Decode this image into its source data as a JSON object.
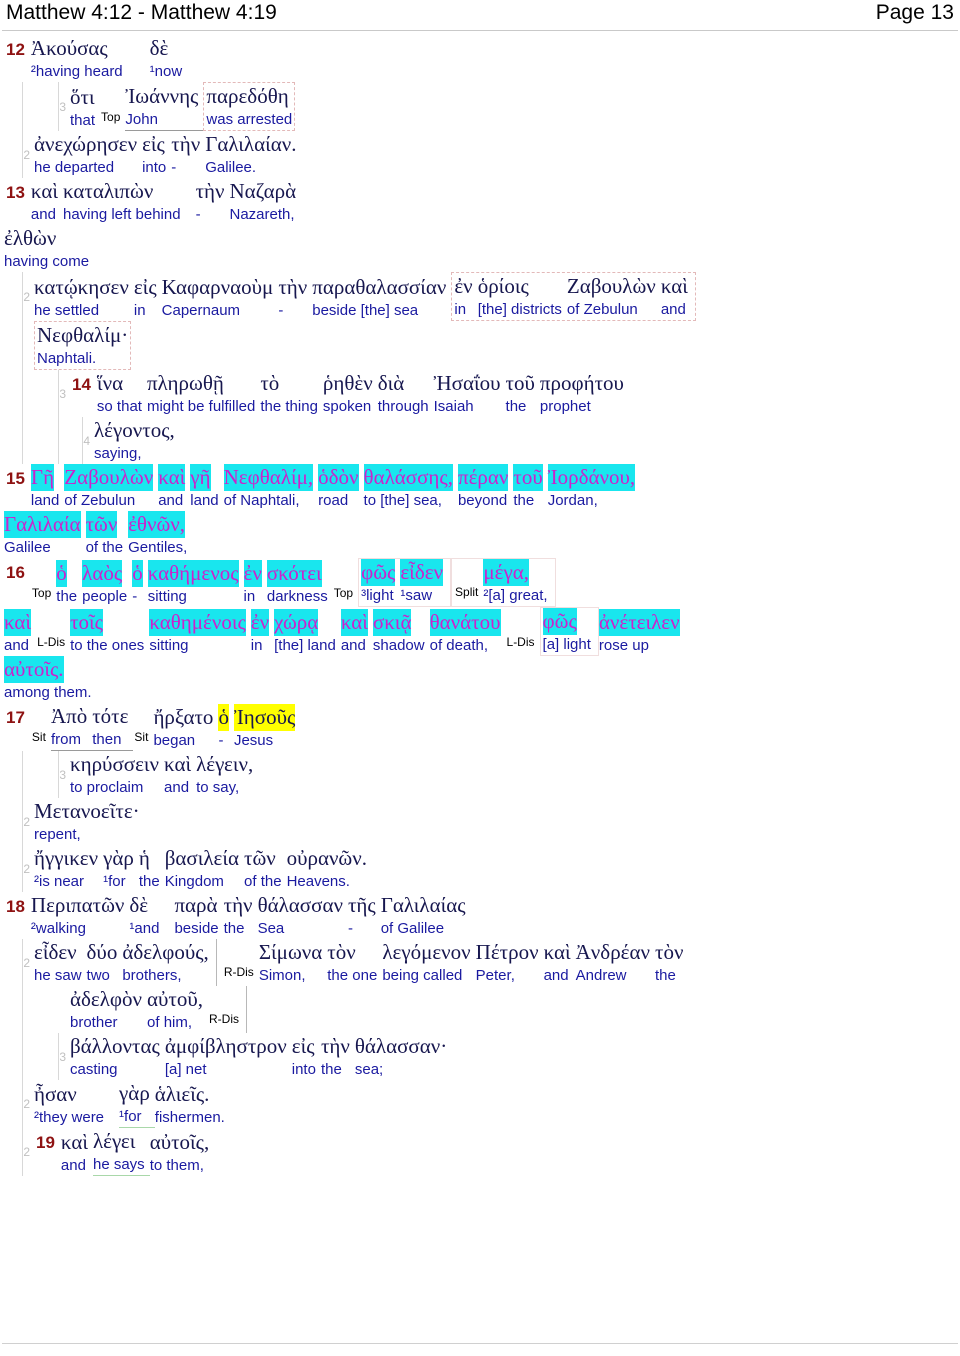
{
  "header": {
    "range_title": "Matthew 4:12 - Matthew 4:19",
    "page_label": "Page 13"
  },
  "colors": {
    "verse_number": "#8e1212",
    "greek_text": "#17174f",
    "english_gloss": "#1a1aa0",
    "highlight_cyan": "#19e6ee",
    "highlight_cyan_text": "#cc22cc",
    "highlight_yellow": "#ffff00",
    "indent_marker": "#c0c0c0",
    "box_dashed": "#e3b9b9"
  },
  "tags": {
    "top": "Top",
    "split": "Split",
    "sit": "Sit",
    "l_dis": "L-Dis",
    "r_dis": "R-Dis"
  },
  "indent_levels": {
    "two": "2",
    "three": "3",
    "four": "4"
  },
  "verses": [
    {
      "number": "12",
      "lines": [
        {
          "indent": "0",
          "words": [
            {
              "gk": "Ἀκούσας",
              "en": "²having heard"
            },
            {
              "gk": "δὲ",
              "en": "¹now"
            }
          ]
        },
        {
          "indent": "3",
          "words": [
            {
              "gk": "ὅτι",
              "en": "that"
            },
            {
              "tag": "Top"
            },
            {
              "gk": "Ἰωάννης",
              "en": "John"
            },
            {
              "gk": "παρεδόθη",
              "en": "was arrested"
            }
          ]
        },
        {
          "indent": "2",
          "words": [
            {
              "gk": "ἀνεχώρησεν",
              "en": "he departed"
            },
            {
              "gk": "εἰς",
              "en": "into"
            },
            {
              "gk": "τὴν",
              "en": "-"
            },
            {
              "gk": "Γαλιλαίαν.",
              "en": "Galilee."
            }
          ]
        }
      ]
    },
    {
      "number": "13",
      "lines": [
        {
          "indent": "0",
          "words": [
            {
              "gk": "καὶ",
              "en": "and"
            },
            {
              "gk": "καταλιπὼν",
              "en": "having left behind"
            },
            {
              "gk": "τὴν",
              "en": "-"
            },
            {
              "gk": "Ναζαρὰ",
              "en": "Nazareth,"
            }
          ]
        },
        {
          "indent": "0",
          "words": [
            {
              "gk": "ἐλθὼν",
              "en": "having come"
            }
          ]
        },
        {
          "indent": "2",
          "words": [
            {
              "gk": "κατῴκησεν",
              "en": "he settled"
            },
            {
              "gk": "εἰς",
              "en": "in"
            },
            {
              "gk": "Καφαρναοὺμ",
              "en": "Capernaum"
            },
            {
              "gk": "τὴν",
              "en": "-"
            },
            {
              "gk": "παραθαλασσίαν",
              "en": "beside [the] sea"
            },
            {
              "gk": "ἐν",
              "en": "in"
            },
            {
              "gk": "ὁρίοις",
              "en": "[the] districts"
            },
            {
              "gk": "Ζαβουλὼν",
              "en": "of Zebulun"
            },
            {
              "gk": "καὶ",
              "en": "and"
            }
          ]
        },
        {
          "indent": "0",
          "words": [
            {
              "gk": "Νεφθαλίμ·",
              "en": "Naphtali."
            }
          ]
        }
      ]
    },
    {
      "number": "14",
      "lines": [
        {
          "indent": "3",
          "words": [
            {
              "gk": "ἵνα",
              "en": "so that"
            },
            {
              "gk": "πληρωθῇ",
              "en": "might be fulfilled"
            },
            {
              "gk": "τὸ",
              "en": "the thing"
            },
            {
              "gk": "ῥηθὲν",
              "en": "spoken"
            },
            {
              "gk": "διὰ",
              "en": "through"
            },
            {
              "gk": "Ἠσαΐου",
              "en": "Isaiah"
            },
            {
              "gk": "τοῦ",
              "en": "the"
            },
            {
              "gk": "προφήτου",
              "en": "prophet"
            }
          ]
        },
        {
          "indent": "4",
          "words": [
            {
              "gk": "λέγοντος,",
              "en": "saying,"
            }
          ]
        }
      ]
    },
    {
      "number": "15",
      "lines": [
        {
          "indent": "0",
          "highlight": "cyan",
          "words": [
            {
              "gk": "Γῆ",
              "en": "land"
            },
            {
              "gk": "Ζαβουλὼν",
              "en": "of Zebulun"
            },
            {
              "gk": "καὶ",
              "en": "and"
            },
            {
              "gk": "γῆ",
              "en": "land"
            },
            {
              "gk": "Νεφθαλίμ,",
              "en": "of Naphtali,"
            },
            {
              "gk": "ὁδὸν",
              "en": "road"
            },
            {
              "gk": "θαλάσσης,",
              "en": "to [the] sea,"
            },
            {
              "gk": "πέραν",
              "en": "beyond"
            },
            {
              "gk": "τοῦ",
              "en": "the"
            },
            {
              "gk": "Ἰορδάνου,",
              "en": "Jordan,"
            }
          ]
        },
        {
          "indent": "0",
          "highlight": "cyan",
          "words": [
            {
              "gk": "Γαλιλαία",
              "en": "Galilee"
            },
            {
              "gk": "τῶν",
              "en": "of the"
            },
            {
              "gk": "ἐθνῶν,",
              "en": "Gentiles,"
            }
          ]
        }
      ]
    },
    {
      "number": "16",
      "lines": [
        {
          "indent": "0",
          "highlight": "cyan",
          "words": [
            {
              "tag": "Top"
            },
            {
              "gk": "ὁ",
              "en": "the"
            },
            {
              "gk": "λαὸς",
              "en": "people"
            },
            {
              "gk": "ὁ",
              "en": "-"
            },
            {
              "gk": "καθήμενος",
              "en": "sitting"
            },
            {
              "gk": "ἐν",
              "en": "in"
            },
            {
              "gk": "σκότει",
              "en": "darkness"
            },
            {
              "tag": "Top"
            },
            {
              "gk": "φῶς",
              "en": "³light"
            },
            {
              "gk": "εἶδεν",
              "en": "¹saw"
            },
            {
              "tag": "Split"
            },
            {
              "gk": "μέγα,",
              "en": "²[a] great,"
            }
          ]
        },
        {
          "indent": "0",
          "highlight": "cyan",
          "words": [
            {
              "gk": "καὶ",
              "en": "and"
            },
            {
              "tag": "L-Dis"
            },
            {
              "gk": "τοῖς",
              "en": "to the ones"
            },
            {
              "gk": "καθημένοις",
              "en": "sitting"
            },
            {
              "gk": "ἐν",
              "en": "in"
            },
            {
              "gk": "χώρᾳ",
              "en": "[the] land"
            },
            {
              "gk": "καὶ",
              "en": "and"
            },
            {
              "gk": "σκιᾷ",
              "en": "shadow"
            },
            {
              "gk": "θανάτου",
              "en": "of death,"
            },
            {
              "tag": "L-Dis"
            },
            {
              "gk": "φῶς",
              "en": "[a] light"
            },
            {
              "gk": "ἀνέτειλεν",
              "en": "rose up"
            }
          ]
        },
        {
          "indent": "0",
          "highlight": "cyan",
          "words": [
            {
              "gk": "αὐτοῖς.",
              "en": "among them."
            }
          ]
        }
      ]
    },
    {
      "number": "17",
      "lines": [
        {
          "indent": "0",
          "words": [
            {
              "tag": "Sit"
            },
            {
              "gk": "Ἀπὸ",
              "en": "from"
            },
            {
              "gk": "τότε",
              "en": "then"
            },
            {
              "tag": "Sit"
            },
            {
              "gk": "ἤρξατο",
              "en": "began"
            },
            {
              "gk": "ὁ",
              "en": "-",
              "highlight": "yellow"
            },
            {
              "gk": "Ἰησοῦς",
              "en": "Jesus",
              "highlight": "yellow"
            }
          ]
        },
        {
          "indent": "3",
          "words": [
            {
              "gk": "κηρύσσειν",
              "en": "to proclaim"
            },
            {
              "gk": "καὶ",
              "en": "and"
            },
            {
              "gk": "λέγειν,",
              "en": "to say,"
            }
          ]
        },
        {
          "indent": "2",
          "words": [
            {
              "gk": "Μετανοεῖτε·",
              "en": "repent,"
            }
          ]
        },
        {
          "indent": "2",
          "words": [
            {
              "gk": "ἤγγικεν",
              "en": "²is near"
            },
            {
              "gk": "γὰρ",
              "en": "¹for"
            },
            {
              "gk": "ἡ",
              "en": "the"
            },
            {
              "gk": "βασιλεία",
              "en": "Kingdom"
            },
            {
              "gk": "τῶν",
              "en": "of the"
            },
            {
              "gk": "οὐρανῶν.",
              "en": "Heavens."
            }
          ]
        }
      ]
    },
    {
      "number": "18",
      "lines": [
        {
          "indent": "0",
          "words": [
            {
              "gk": "Περιπατῶν",
              "en": "²walking"
            },
            {
              "gk": "δὲ",
              "en": "¹and"
            },
            {
              "gk": "παρὰ",
              "en": "beside"
            },
            {
              "gk": "τὴν",
              "en": "the"
            },
            {
              "gk": "θάλασσαν",
              "en": "Sea"
            },
            {
              "gk": "τῆς",
              "en": "-"
            },
            {
              "gk": "Γαλιλαίας",
              "en": "of Galilee"
            }
          ]
        },
        {
          "indent": "2",
          "words": [
            {
              "gk": "εἶδεν",
              "en": "he saw"
            },
            {
              "gk": "δύο",
              "en": "two"
            },
            {
              "gk": "ἀδελφούς,",
              "en": "brothers,"
            },
            {
              "tag": "R-Dis"
            },
            {
              "gk": "Σίμωνα",
              "en": "Simon,"
            },
            {
              "gk": "τὸν",
              "en": "the one"
            },
            {
              "gk": "λεγόμενον",
              "en": "being called"
            },
            {
              "gk": "Πέτρον",
              "en": "Peter,"
            },
            {
              "gk": "καὶ",
              "en": "and"
            },
            {
              "gk": "Ἀνδρέαν",
              "en": "Andrew"
            },
            {
              "gk": "τὸν",
              "en": "the"
            }
          ]
        },
        {
          "indent": "0",
          "words": [
            {
              "gk": "ἀδελφὸν",
              "en": "brother"
            },
            {
              "gk": "αὐτοῦ,",
              "en": "of him,"
            },
            {
              "tag": "R-Dis"
            }
          ]
        },
        {
          "indent": "3",
          "words": [
            {
              "gk": "βάλλοντας",
              "en": "casting"
            },
            {
              "gk": "ἀμφίβληστρον",
              "en": "[a] net"
            },
            {
              "gk": "εἰς",
              "en": "into"
            },
            {
              "gk": "τὴν",
              "en": "the"
            },
            {
              "gk": "θάλασσαν·",
              "en": "sea;"
            }
          ]
        },
        {
          "indent": "2",
          "words": [
            {
              "gk": "ἦσαν",
              "en": "²they were"
            },
            {
              "gk": "γὰρ",
              "en": "¹for"
            },
            {
              "gk": "ἁλιεῖς.",
              "en": "fishermen."
            }
          ]
        }
      ]
    },
    {
      "number": "19",
      "lines": [
        {
          "indent": "2",
          "words": [
            {
              "gk": "καὶ",
              "en": "and"
            },
            {
              "gk": "λέγει",
              "en": "he says"
            },
            {
              "gk": "αὐτοῖς,",
              "en": "to them,"
            }
          ]
        }
      ]
    }
  ]
}
